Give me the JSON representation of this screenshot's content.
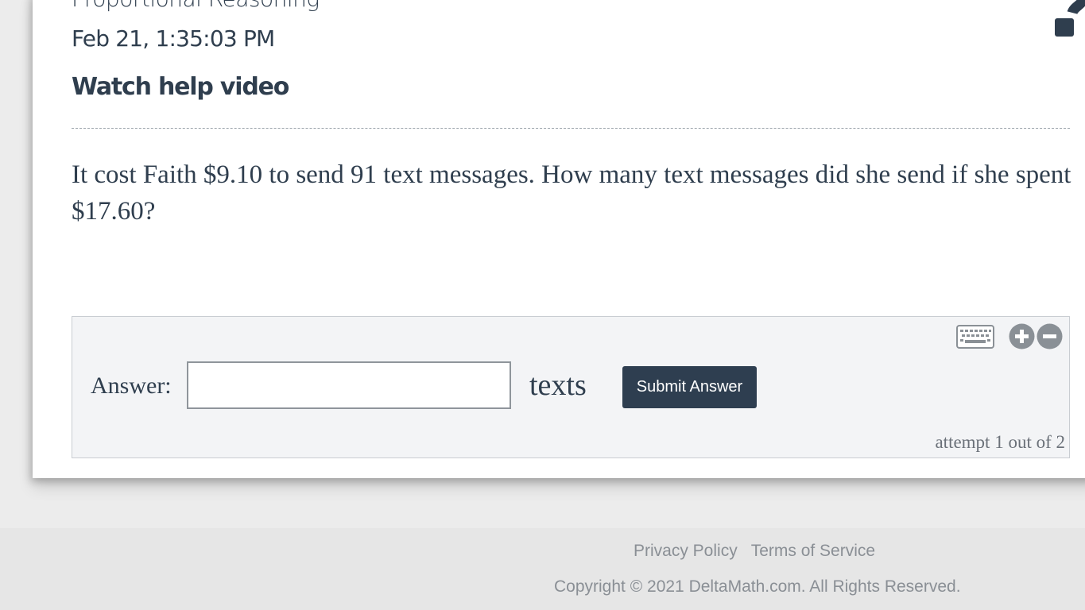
{
  "header": {
    "topic": "Proportional Reasoning",
    "timestamp": "Feb 21, 1:35:03 PM",
    "help_video_link": "Watch help video",
    "help_icon": "question-mark-icon"
  },
  "problem": {
    "question": "It cost Faith $9.10 to send 91 text messages. How many text messages did she send if she spent $17.60?"
  },
  "answer_panel": {
    "tools": [
      "keyboard-icon",
      "zoom-in-icon",
      "zoom-out-icon"
    ],
    "label": "Answer:",
    "input_value": "",
    "unit": "texts",
    "submit_label": "Submit Answer",
    "attempt_text": "attempt 1 out of 2"
  },
  "footer": {
    "privacy_link": "Privacy Policy",
    "terms_link": "Terms of Service",
    "copyright": "Copyright © 2021 DeltaMath.com. All Rights Reserved."
  },
  "colors": {
    "primary": "#2e3e50",
    "panel_bg": "#f3f4f6",
    "muted_text": "#8a8f95",
    "page_bg": "#ececec"
  }
}
